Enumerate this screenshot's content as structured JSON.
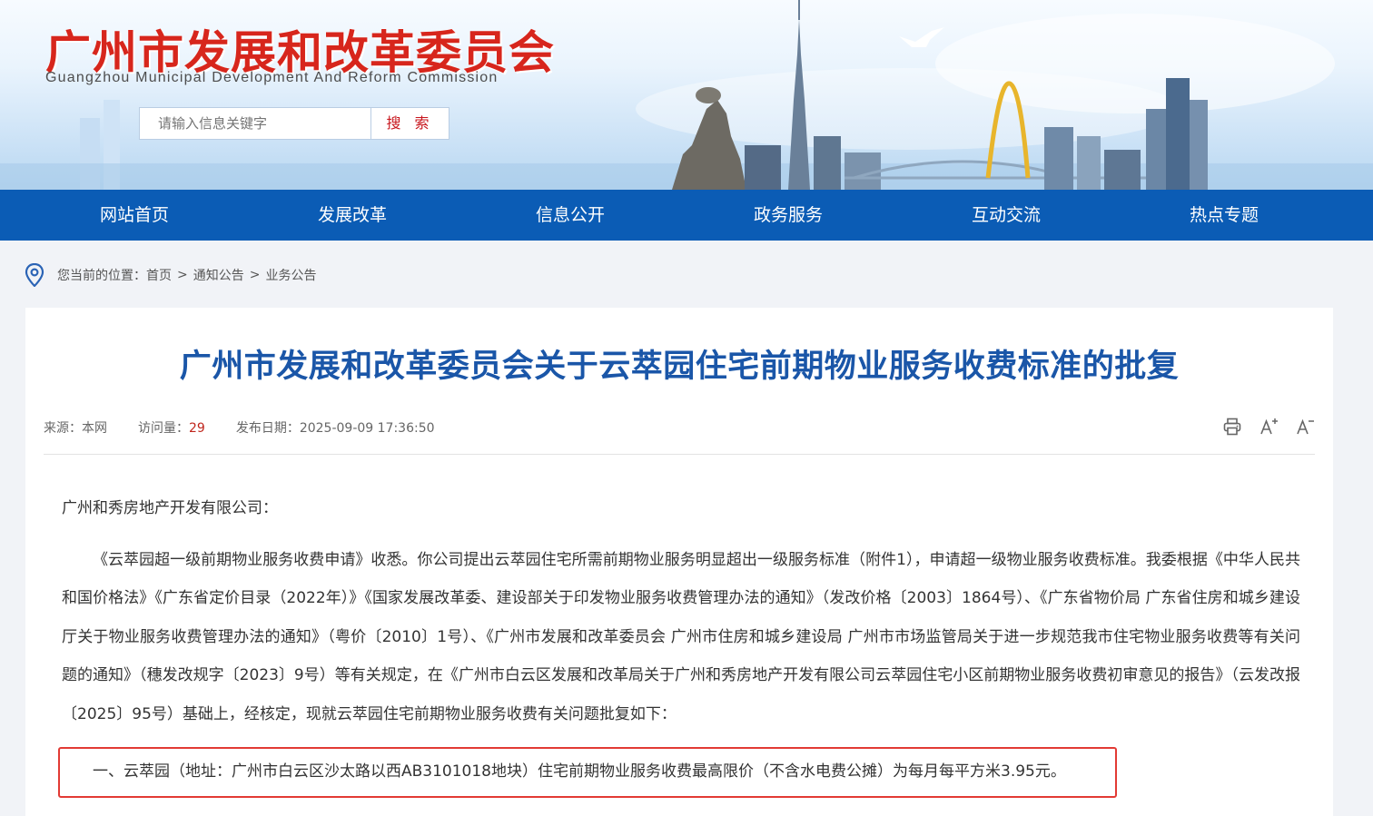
{
  "header": {
    "title": "广州市发展和改革委员会",
    "subtitle": "Guangzhou Municipal Development And Reform Commission",
    "search_placeholder": "请输入信息关键字",
    "search_button": "搜 索"
  },
  "nav": {
    "items": [
      "网站首页",
      "发展改革",
      "信息公开",
      "政务服务",
      "互动交流",
      "热点专题"
    ]
  },
  "breadcrumb": {
    "prefix": "您当前的位置：",
    "items": [
      "首页",
      "通知公告",
      "业务公告"
    ],
    "separator": ">"
  },
  "article": {
    "title": "广州市发展和改革委员会关于云萃园住宅前期物业服务收费标准的批复",
    "meta": {
      "source_label": "来源：",
      "source": "本网",
      "visits_label": "访问量：",
      "visits": "29",
      "date_label": "发布日期：",
      "date": "2025-09-09 17:36:50"
    },
    "tools": [
      "print-icon",
      "font-increase-icon",
      "font-decrease-icon"
    ],
    "salutation": "广州和秀房地产开发有限公司：",
    "paragraph1": "《云萃园超一级前期物业服务收费申请》收悉。你公司提出云萃园住宅所需前期物业服务明显超出一级服务标准（附件1），申请超一级物业服务收费标准。我委根据《中华人民共和国价格法》《广东省定价目录（2022年）》《国家发展改革委、建设部关于印发物业服务收费管理办法的通知》（发改价格〔2003〕1864号）、《广东省物价局 广东省住房和城乡建设厅关于物业服务收费管理办法的通知》（粤价〔2010〕1号）、《广州市发展和改革委员会 广州市住房和城乡建设局 广州市市场监管局关于进一步规范我市住宅物业服务收费等有关问题的通知》（穗发改规字〔2023〕9号）等有关规定，在《广州市白云区发展和改革局关于广州和秀房地产开发有限公司云萃园住宅小区前期物业服务收费初审意见的报告》（云发改报〔2025〕95号）基础上，经核定，现就云萃园住宅前期物业服务收费有关问题批复如下：",
    "paragraph2": "一、云萃园（地址：广州市白云区沙太路以西AB3101018地块）住宅前期物业服务收费最高限价（不含水电费公摊）为每月每平方米3.95元。"
  },
  "colors": {
    "nav_bg": "#0b5cb5",
    "title_red": "#d7261c",
    "article_title_blue": "#1a56a8",
    "highlight_border": "#e23a34"
  }
}
